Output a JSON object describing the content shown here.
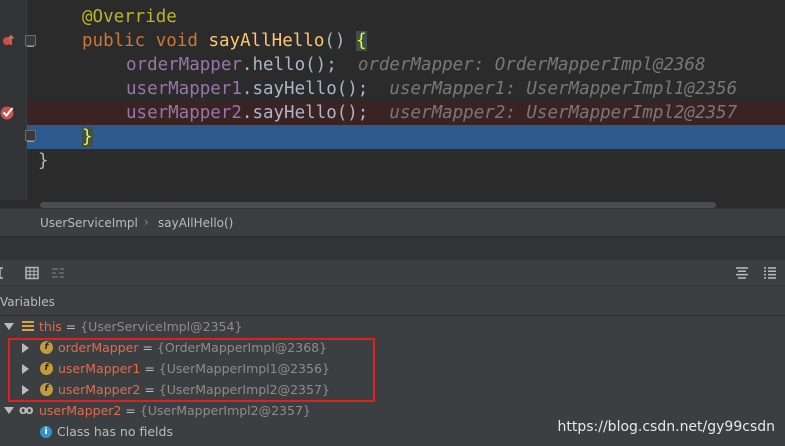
{
  "editor": {
    "lines": {
      "annotation": "@Override",
      "sig_public": "public",
      "sig_void": "void",
      "sig_name": "sayAllHello",
      "sig_parens": "() ",
      "sig_brace": "{",
      "l3_field": "orderMapper",
      "l3_call": ".hello();",
      "l3_hint": "orderMapper: OrderMapperImpl@2368",
      "l4_field": "userMapper1",
      "l4_call": ".sayHello();",
      "l4_hint": "userMapper1: UserMapperImpl1@2356",
      "l5_field": "userMapper2",
      "l5_call": ".sayHello();",
      "l5_hint": "userMapper2: UserMapperImpl2@2357",
      "l6_brace": "}",
      "l7_brace": "}"
    }
  },
  "breadcrumb": {
    "items": [
      "UserServiceImpl",
      "sayAllHello()"
    ]
  },
  "debug": {
    "vars_title": "Variables",
    "rows": [
      {
        "name": "this",
        "eq": " = ",
        "value": "{UserServiceImpl@2354}"
      },
      {
        "name": "orderMapper",
        "eq": " = ",
        "value": "{OrderMapperImpl@2368}"
      },
      {
        "name": "userMapper1",
        "eq": " = ",
        "value": "{UserMapperImpl1@2356}"
      },
      {
        "name": "userMapper2",
        "eq": " = ",
        "value": "{UserMapperImpl2@2357}"
      },
      {
        "name": "userMapper2",
        "eq": " = ",
        "value": "{UserMapperImpl2@2357}"
      }
    ],
    "info": "Class has no fields",
    "field_badge": "f",
    "watch_badge": "oo",
    "info_badge": "i"
  },
  "watermark": "https://blog.csdn.net/gy99csdn",
  "colors": {
    "background": "#2b2b2b",
    "panel": "#3c3f41",
    "current_line": "#2d5a8c",
    "error_line": "#3b2323",
    "highlight_box": "#e02020",
    "keyword": "#cc7832",
    "function": "#ffc66d",
    "field": "#9876aa",
    "annotation": "#bbb529"
  }
}
